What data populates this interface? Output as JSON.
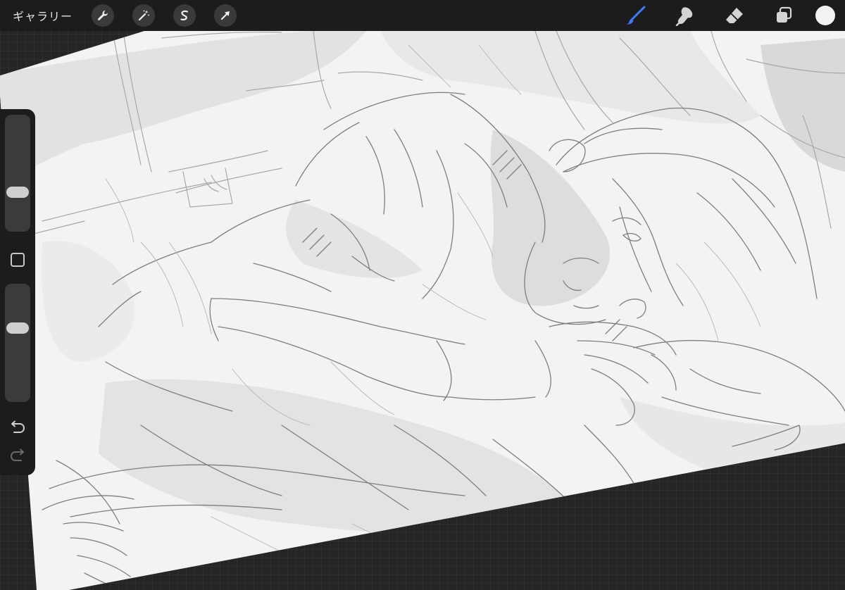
{
  "toolbar": {
    "gallery_label": "ギャラリー",
    "left_tools": [
      "wrench-icon",
      "magic-wand-icon",
      "selection-s-icon",
      "transform-arrow-icon"
    ],
    "right_tools": [
      "brush-icon",
      "smudge-icon",
      "eraser-icon",
      "layers-icon"
    ],
    "active_tool": "brush",
    "accent_color": "#3d7cf5",
    "current_color": "#f2f2f2"
  },
  "sidebar": {
    "brush_size_level": 0.65,
    "opacity_level": 0.4,
    "undo_icon": "undo-arrow-icon",
    "redo_icon": "redo-arrow-icon"
  },
  "canvas": {
    "paper_color": "#f3f3f3",
    "background_color": "#252527"
  }
}
